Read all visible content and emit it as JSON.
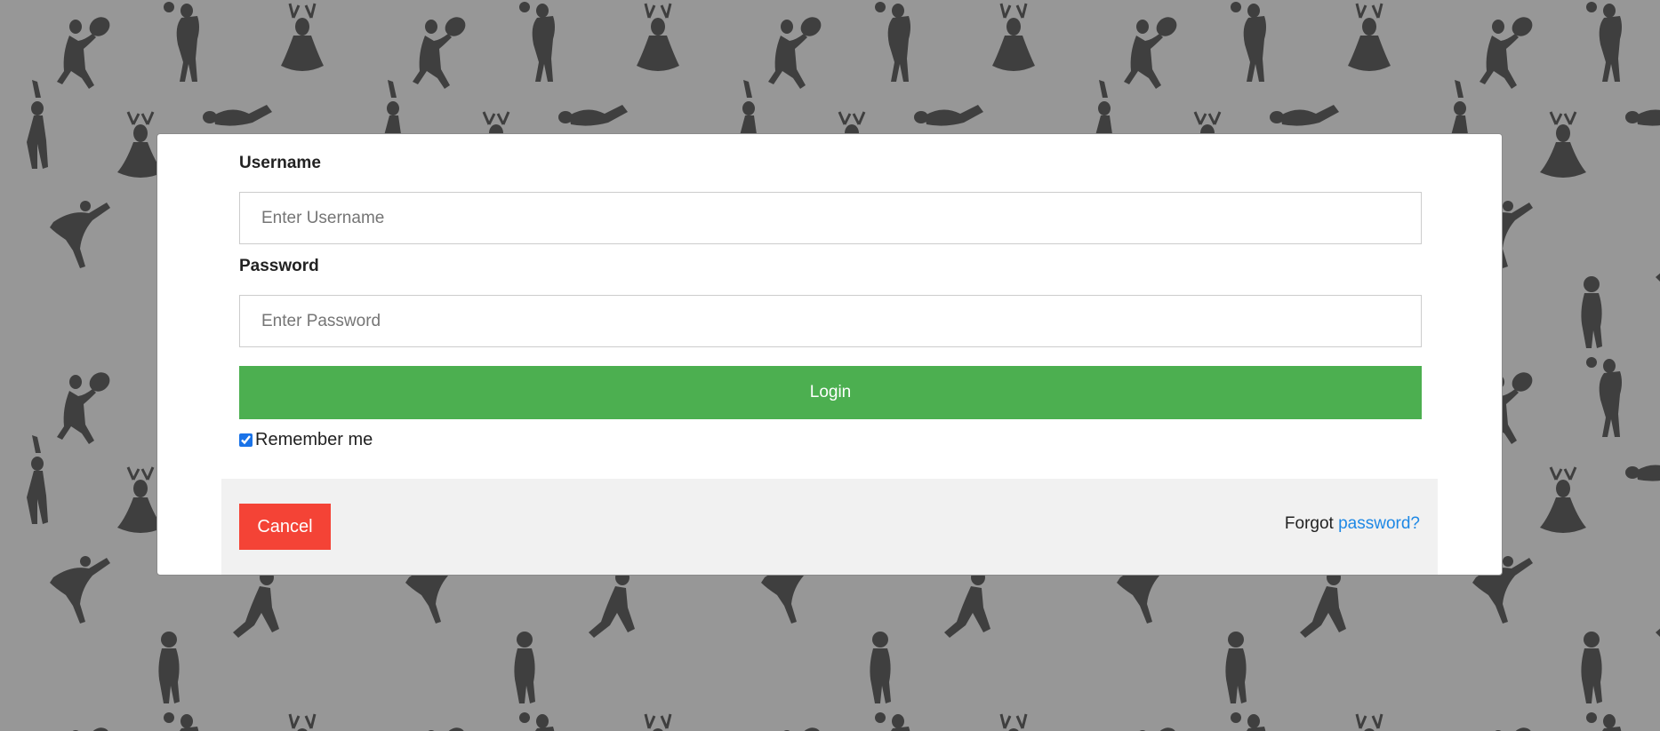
{
  "background": {
    "color": "#979797",
    "pattern": "sports-silhouettes"
  },
  "form": {
    "username_label": "Username",
    "username_placeholder": "Enter Username",
    "username_value": "",
    "password_label": "Password",
    "password_placeholder": "Enter Password",
    "password_value": "",
    "login_label": "Login",
    "remember_label": "Remember me",
    "remember_checked": true
  },
  "footer": {
    "cancel_label": "Cancel",
    "forgot_prefix": "Forgot",
    "forgot_link": "password?"
  },
  "colors": {
    "login_button": "#4caf50",
    "cancel_button": "#f44336",
    "link": "#1e88e5",
    "footer_bg": "#f1f1f1"
  }
}
